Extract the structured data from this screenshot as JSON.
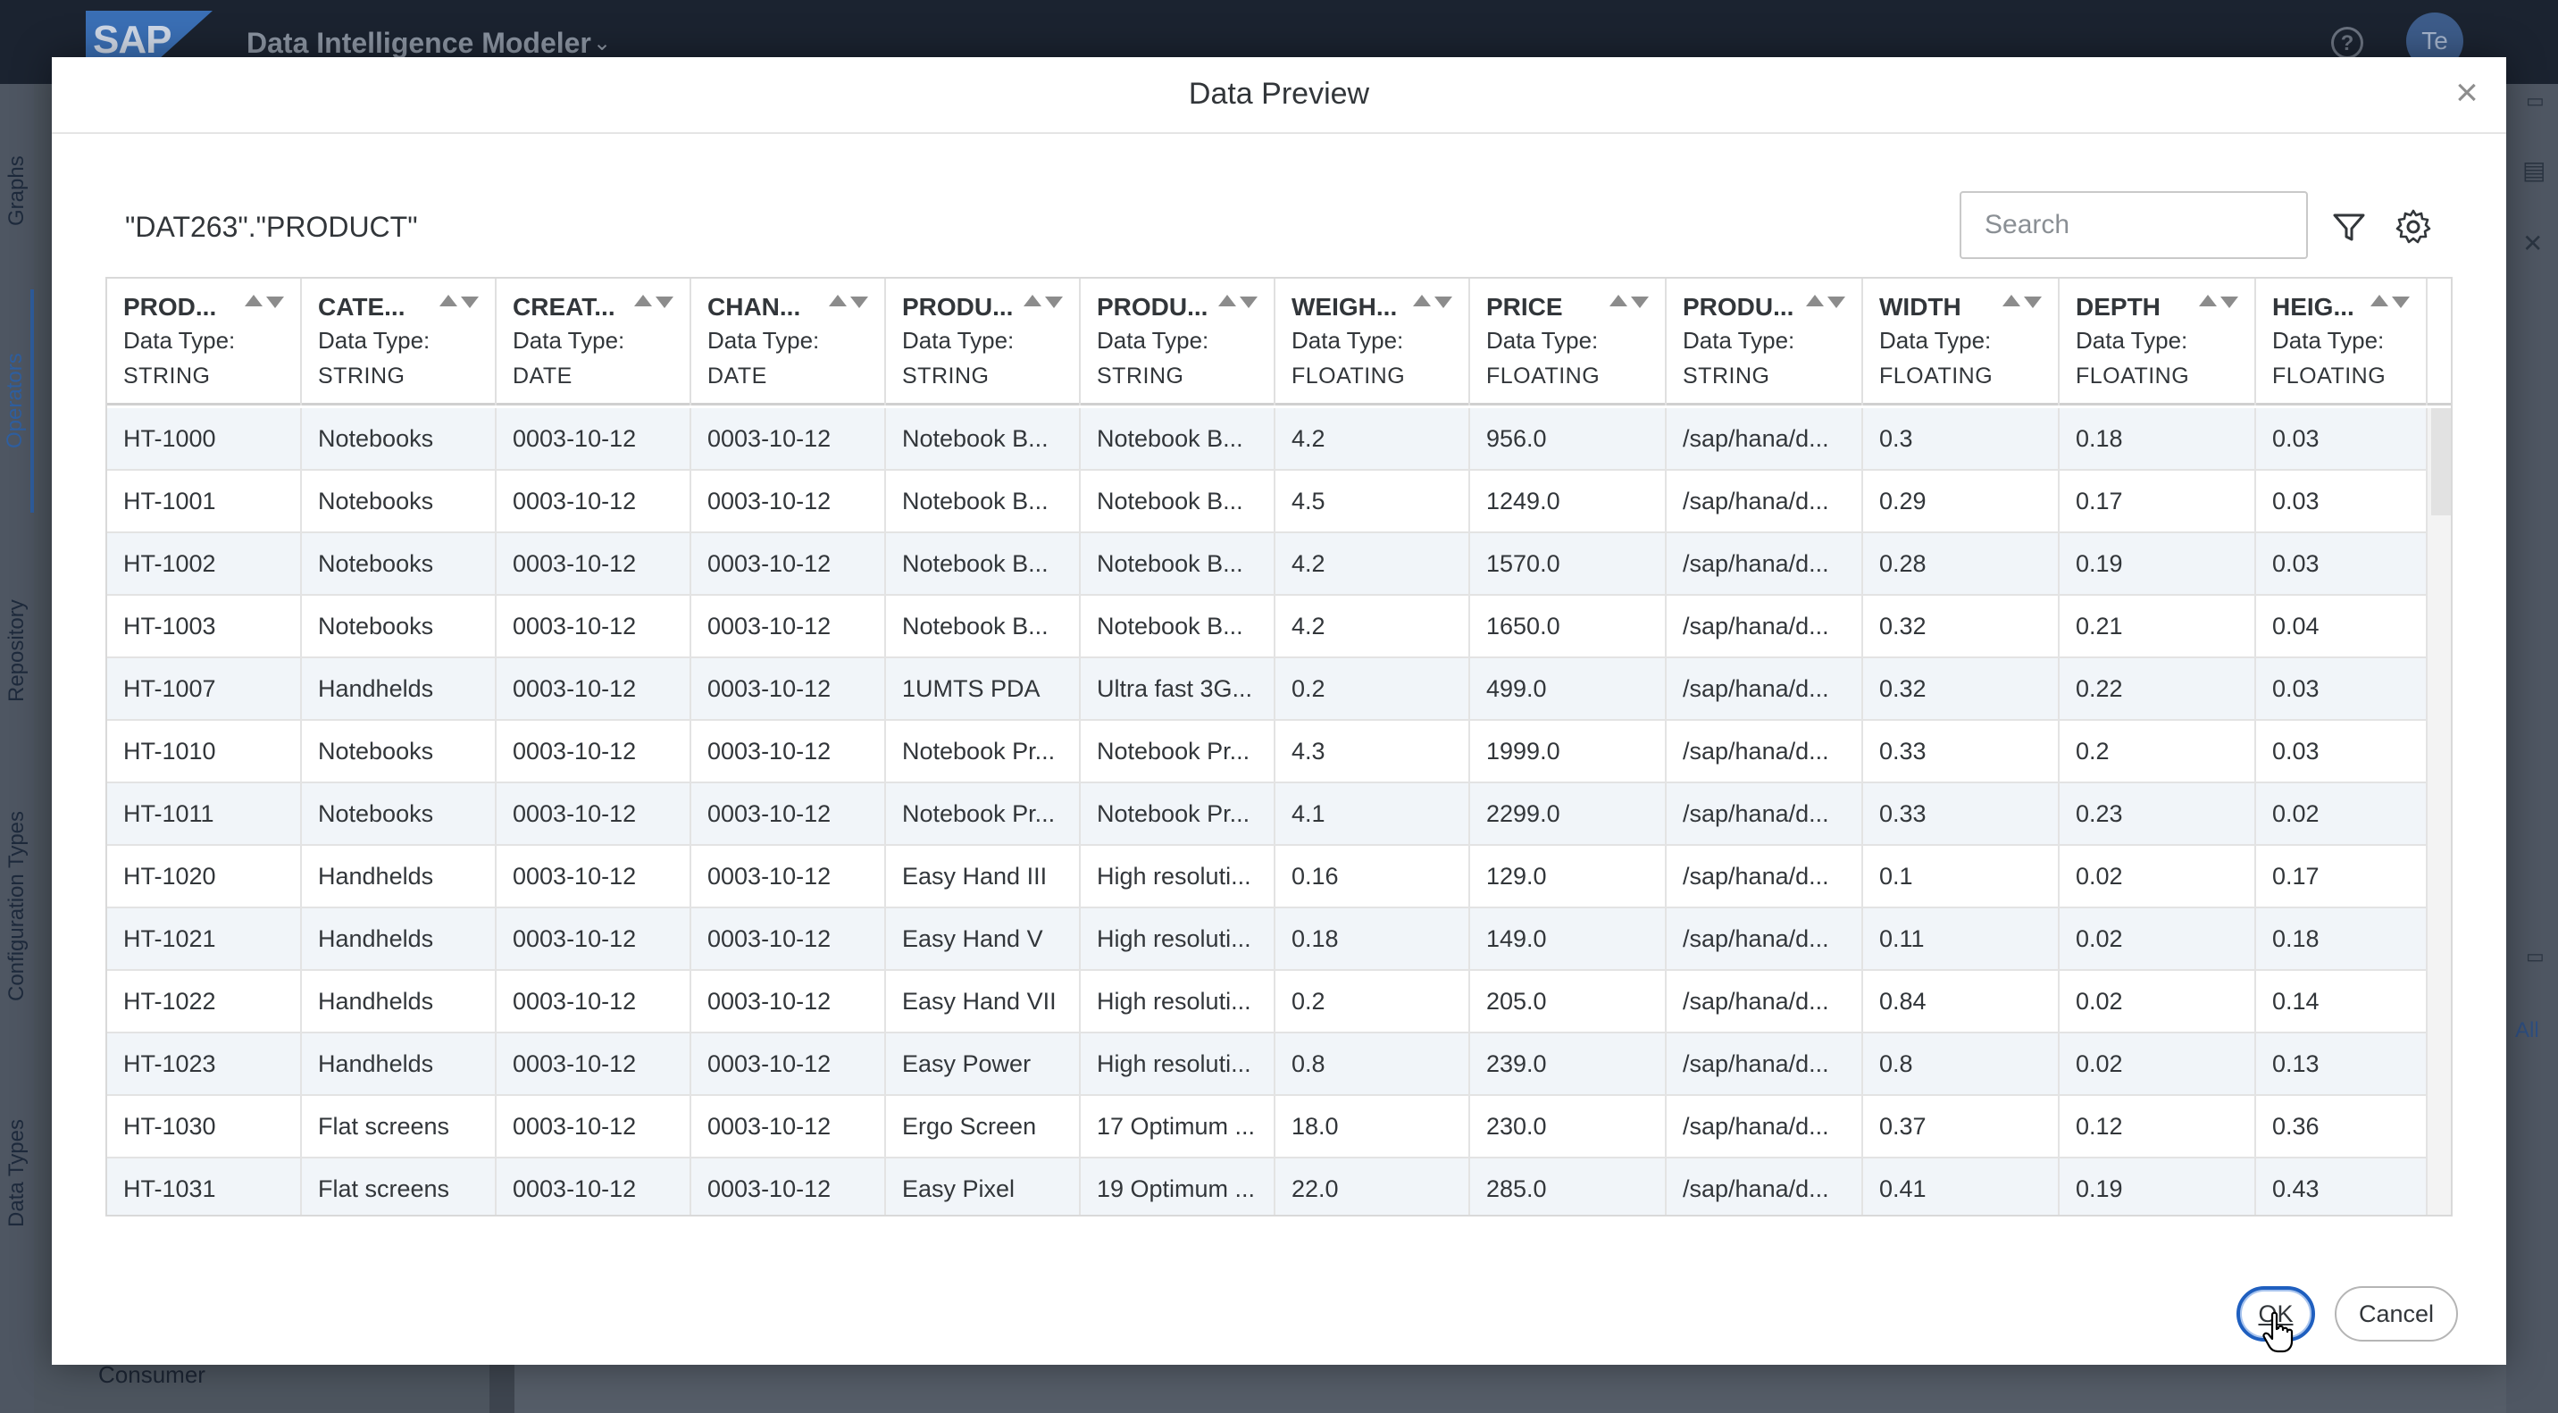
{
  "shell": {
    "logo": "SAP",
    "title": "Data Intelligence Modeler",
    "help_glyph": "?",
    "user_initials": "Te"
  },
  "side_tabs": [
    "Graphs",
    "Operators",
    "Repository",
    "Configuration Types",
    "Data Types"
  ],
  "left_panel": {
    "consumer_label": "Consumer"
  },
  "background_right": {
    "all_label": "All",
    "close_glyph": "✕"
  },
  "dialog": {
    "title": "Data Preview",
    "close_glyph": "×",
    "source_name": "\"DAT263\".\"PRODUCT\"",
    "search_placeholder": "Search",
    "ok_label": "OK",
    "cancel_label": "Cancel"
  },
  "table": {
    "columns": [
      {
        "name": "PROD...",
        "dtl": "Data Type:",
        "type": "STRING"
      },
      {
        "name": "CATE...",
        "dtl": "Data Type:",
        "type": "STRING"
      },
      {
        "name": "CREAT...",
        "dtl": "Data Type:",
        "type": "DATE"
      },
      {
        "name": "CHAN...",
        "dtl": "Data Type:",
        "type": "DATE"
      },
      {
        "name": "PRODU...",
        "dtl": "Data Type:",
        "type": "STRING"
      },
      {
        "name": "PRODU...",
        "dtl": "Data Type:",
        "type": "STRING"
      },
      {
        "name": "WEIGH...",
        "dtl": "Data Type:",
        "type": "FLOATING"
      },
      {
        "name": "PRICE",
        "dtl": "Data Type:",
        "type": "FLOATING"
      },
      {
        "name": "PRODU...",
        "dtl": "Data Type:",
        "type": "STRING"
      },
      {
        "name": "WIDTH",
        "dtl": "Data Type:",
        "type": "FLOATING"
      },
      {
        "name": "DEPTH",
        "dtl": "Data Type:",
        "type": "FLOATING"
      },
      {
        "name": "HEIG...",
        "dtl": "Data Type:",
        "type": "FLOATING"
      }
    ],
    "rows": [
      [
        "HT-1000",
        "Notebooks",
        "0003-10-12",
        "0003-10-12",
        "Notebook B...",
        "Notebook B...",
        "4.2",
        "956.0",
        "/sap/hana/d...",
        "0.3",
        "0.18",
        "0.03"
      ],
      [
        "HT-1001",
        "Notebooks",
        "0003-10-12",
        "0003-10-12",
        "Notebook B...",
        "Notebook B...",
        "4.5",
        "1249.0",
        "/sap/hana/d...",
        "0.29",
        "0.17",
        "0.03"
      ],
      [
        "HT-1002",
        "Notebooks",
        "0003-10-12",
        "0003-10-12",
        "Notebook B...",
        "Notebook B...",
        "4.2",
        "1570.0",
        "/sap/hana/d...",
        "0.28",
        "0.19",
        "0.03"
      ],
      [
        "HT-1003",
        "Notebooks",
        "0003-10-12",
        "0003-10-12",
        "Notebook B...",
        "Notebook B...",
        "4.2",
        "1650.0",
        "/sap/hana/d...",
        "0.32",
        "0.21",
        "0.04"
      ],
      [
        "HT-1007",
        "Handhelds",
        "0003-10-12",
        "0003-10-12",
        "1UMTS PDA",
        "Ultra fast 3G...",
        "0.2",
        "499.0",
        "/sap/hana/d...",
        "0.32",
        "0.22",
        "0.03"
      ],
      [
        "HT-1010",
        "Notebooks",
        "0003-10-12",
        "0003-10-12",
        "Notebook Pr...",
        "Notebook Pr...",
        "4.3",
        "1999.0",
        "/sap/hana/d...",
        "0.33",
        "0.2",
        "0.03"
      ],
      [
        "HT-1011",
        "Notebooks",
        "0003-10-12",
        "0003-10-12",
        "Notebook Pr...",
        "Notebook Pr...",
        "4.1",
        "2299.0",
        "/sap/hana/d...",
        "0.33",
        "0.23",
        "0.02"
      ],
      [
        "HT-1020",
        "Handhelds",
        "0003-10-12",
        "0003-10-12",
        "Easy Hand III",
        "High resoluti...",
        "0.16",
        "129.0",
        "/sap/hana/d...",
        "0.1",
        "0.02",
        "0.17"
      ],
      [
        "HT-1021",
        "Handhelds",
        "0003-10-12",
        "0003-10-12",
        "Easy Hand V",
        "High resoluti...",
        "0.18",
        "149.0",
        "/sap/hana/d...",
        "0.11",
        "0.02",
        "0.18"
      ],
      [
        "HT-1022",
        "Handhelds",
        "0003-10-12",
        "0003-10-12",
        "Easy Hand VII",
        "High resoluti...",
        "0.2",
        "205.0",
        "/sap/hana/d...",
        "0.84",
        "0.02",
        "0.14"
      ],
      [
        "HT-1023",
        "Handhelds",
        "0003-10-12",
        "0003-10-12",
        "Easy Power",
        "High resoluti...",
        "0.8",
        "239.0",
        "/sap/hana/d...",
        "0.8",
        "0.02",
        "0.13"
      ],
      [
        "HT-1030",
        "Flat screens",
        "0003-10-12",
        "0003-10-12",
        "Ergo Screen",
        "17 Optimum ...",
        "18.0",
        "230.0",
        "/sap/hana/d...",
        "0.37",
        "0.12",
        "0.36"
      ],
      [
        "HT-1031",
        "Flat screens",
        "0003-10-12",
        "0003-10-12",
        "Easy Pixel",
        "19 Optimum ...",
        "22.0",
        "285.0",
        "/sap/hana/d...",
        "0.41",
        "0.19",
        "0.43"
      ]
    ]
  },
  "colors": {
    "shell_bg": "#1b2330",
    "accent": "#1f5fbf",
    "row_alt": "#f1f5f9"
  }
}
